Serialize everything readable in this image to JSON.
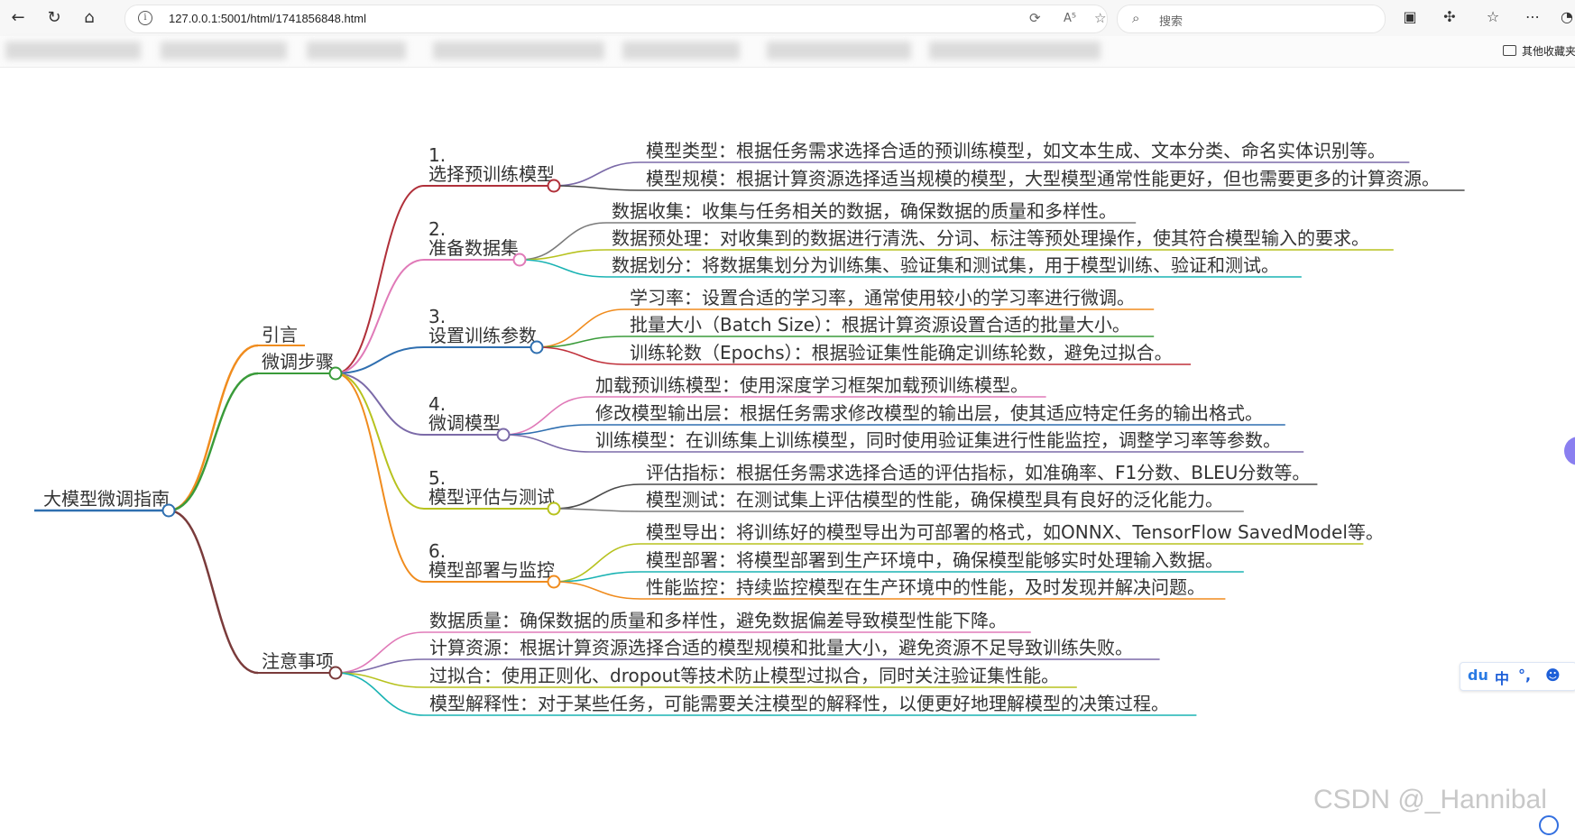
{
  "browser": {
    "url": "127.0.0.1:5001/html/1741856848.html",
    "search_placeholder": "搜索",
    "read_aloud_glyph": "A⁵",
    "other_bookmarks": "其他收藏夹"
  },
  "mindmap": {
    "root": "大模型微调指南",
    "intro": "引言",
    "steps_label": "微调步骤",
    "steps": [
      {
        "num": "1.",
        "title": "选择预训练模型",
        "items": [
          "模型类型：根据任务需求选择合适的预训练模型，如文本生成、文本分类、命名实体识别等。",
          "模型规模：根据计算资源选择适当规模的模型，大型模型通常性能更好，但也需要更多的计算资源。"
        ]
      },
      {
        "num": "2.",
        "title": "准备数据集",
        "items": [
          "数据收集：收集与任务相关的数据，确保数据的质量和多样性。",
          "数据预处理：对收集到的数据进行清洗、分词、标注等预处理操作，使其符合模型输入的要求。",
          "数据划分：将数据集划分为训练集、验证集和测试集，用于模型训练、验证和测试。"
        ]
      },
      {
        "num": "3.",
        "title": "设置训练参数",
        "items": [
          "学习率：设置合适的学习率，通常使用较小的学习率进行微调。",
          "批量大小（Batch Size）：根据计算资源设置合适的批量大小。",
          "训练轮数（Epochs）：根据验证集性能确定训练轮数，避免过拟合。"
        ]
      },
      {
        "num": "4.",
        "title": "微调模型",
        "items": [
          "加载预训练模型：使用深度学习框架加载预训练模型。",
          "修改模型输出层：根据任务需求修改模型的输出层，使其适应特定任务的输出格式。",
          "训练模型：在训练集上训练模型，同时使用验证集进行性能监控，调整学习率等参数。"
        ]
      },
      {
        "num": "5.",
        "title": "模型评估与测试",
        "items": [
          "评估指标：根据任务需求选择合适的评估指标，如准确率、F1分数、BLEU分数等。",
          "模型测试：在测试集上评估模型的性能，确保模型具有良好的泛化能力。"
        ]
      },
      {
        "num": "6.",
        "title": "模型部署与监控",
        "items": [
          "模型导出：将训练好的模型导出为可部署的格式，如ONNX、TensorFlow SavedModel等。",
          "模型部署：将模型部署到生产环境中，确保模型能够实时处理输入数据。",
          "性能监控：持续监控模型在生产环境中的性能，及时发现并解决问题。"
        ]
      }
    ],
    "notes_label": "注意事项",
    "notes": [
      "数据质量：确保数据的质量和多样性，避免数据偏差导致模型性能下降。",
      "计算资源：根据计算资源选择合适的模型规模和批量大小，避免资源不足导致训练失败。",
      "过拟合：使用正则化、dropout等技术防止模型过拟合，同时关注验证集性能。",
      "模型解释性：对于某些任务，可能需要关注模型的解释性，以便更好地理解模型的决策过程。"
    ]
  },
  "watermark": "CSDN @_Hannibal",
  "ime_bar": {
    "lang": "中",
    "punct": "°,"
  },
  "colors": {
    "root": "#2f6fb0",
    "intro": "#f08c1e",
    "steps": "#3a9b3a",
    "notes": "#7a3b3b",
    "step1": "#b0303a",
    "step2": "#e07ab8",
    "step3": "#2f6fb0",
    "step4": "#7b6aa8",
    "step5": "#b7c21e",
    "step6": "#f08c1e"
  }
}
